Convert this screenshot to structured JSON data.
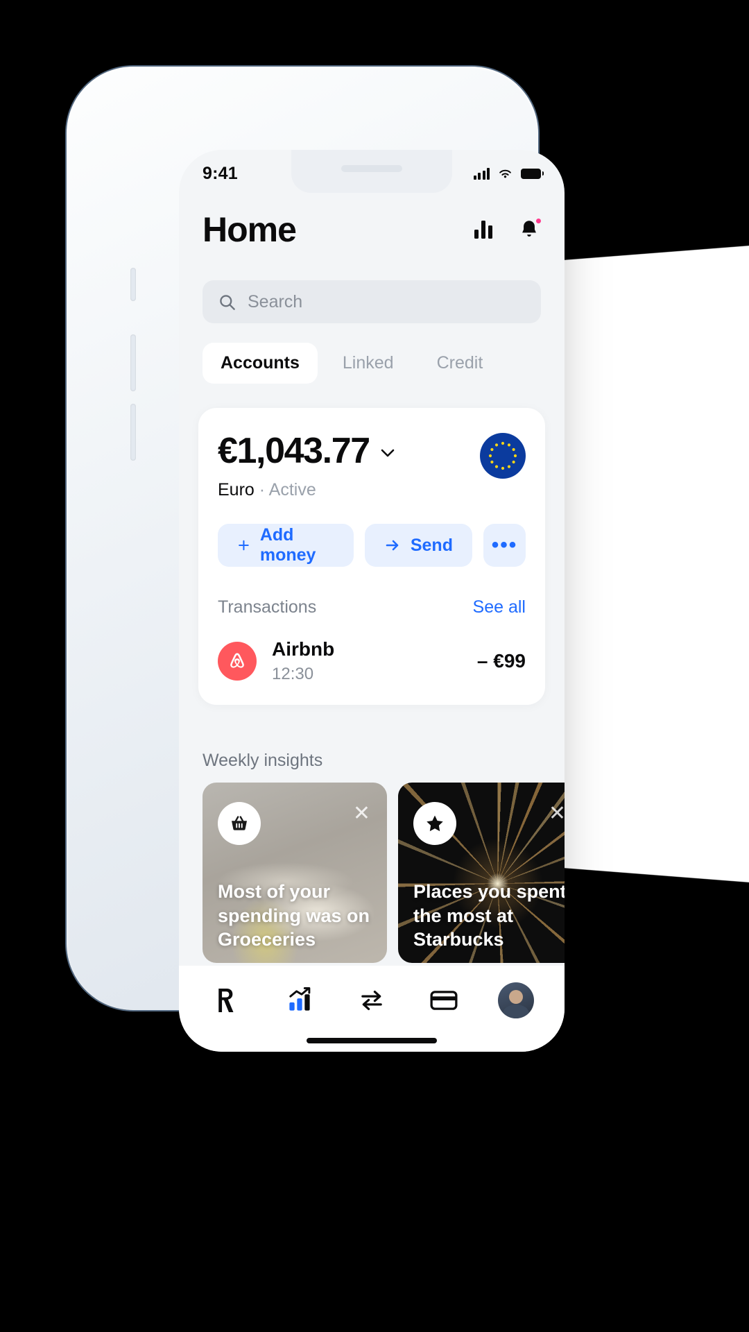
{
  "status_bar": {
    "time": "9:41",
    "signal_icon": "cellular-signal-icon",
    "wifi_icon": "wifi-icon",
    "battery_icon": "battery-icon"
  },
  "header": {
    "title": "Home",
    "stats_icon": "bar-chart-icon",
    "notifications_icon": "bell-icon",
    "has_notification_badge": true
  },
  "search": {
    "placeholder": "Search",
    "icon": "search-icon"
  },
  "tabs": [
    {
      "label": "Accounts",
      "active": true
    },
    {
      "label": "Linked",
      "active": false
    },
    {
      "label": "Credit",
      "active": false
    }
  ],
  "account": {
    "balance": "€1,043.77",
    "chevron_icon": "chevron-down-icon",
    "currency": "Euro",
    "separator": " · ",
    "status": "Active",
    "flag_icon": "eu-flag-icon",
    "flag_color": "#0b3b9e",
    "flag_star_color": "#f7d417",
    "actions": [
      {
        "label": "Add money",
        "icon": "plus-icon"
      },
      {
        "label": "Send",
        "icon": "arrow-right-icon"
      },
      {
        "label": "•••",
        "icon": "more-icon"
      }
    ]
  },
  "transactions": {
    "heading": "Transactions",
    "see_all": "See all",
    "items": [
      {
        "merchant": "Airbnb",
        "time": "12:30",
        "amount": "– €99",
        "logo_icon": "airbnb-logo-icon",
        "logo_color": "#ff585d"
      }
    ]
  },
  "insights": {
    "heading": "Weekly insights",
    "cards": [
      {
        "badge_icon": "basket-icon",
        "close_icon": "close-icon",
        "text": "Most of your spending was on Groeceries"
      },
      {
        "badge_icon": "star-icon",
        "close_icon": "close-icon",
        "text": "Places you spent the most at Starbucks"
      },
      {
        "badge_icon": "",
        "close_icon": "",
        "text": ""
      }
    ]
  },
  "bottom_nav": [
    {
      "name": "revolut-logo-icon",
      "label": "R"
    },
    {
      "name": "analytics-icon",
      "label": ""
    },
    {
      "name": "transfer-icon",
      "label": ""
    },
    {
      "name": "card-icon",
      "label": ""
    },
    {
      "name": "profile-avatar",
      "label": ""
    }
  ],
  "theme": {
    "accent": "#1f6bff",
    "accent_soft": "#e8f0fe",
    "background": "#f3f5f7",
    "card": "#ffffff",
    "text": "#0b0b0c",
    "muted": "#8a9099",
    "badge": "#ff3b8e"
  }
}
